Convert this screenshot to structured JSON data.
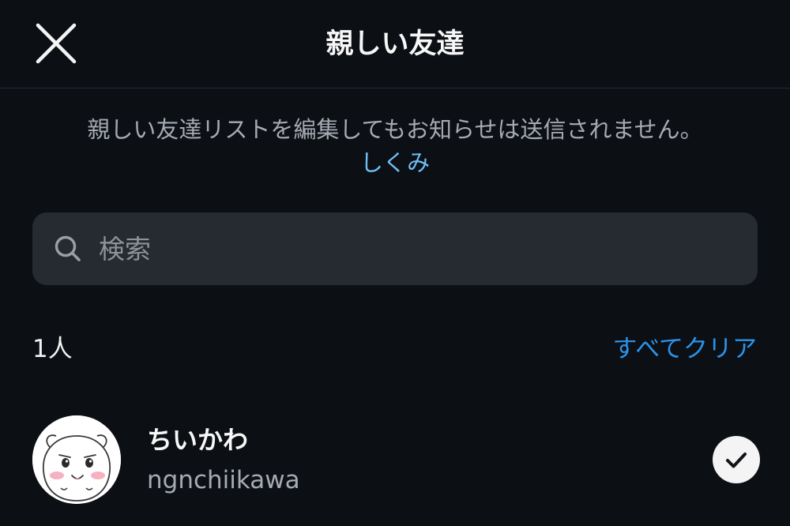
{
  "header": {
    "title": "親しい友達",
    "close_icon": "close-icon"
  },
  "notice": {
    "text": "親しい友達リストを編集してもお知らせは送信されません。",
    "link": "しくみ"
  },
  "search": {
    "placeholder": "検索",
    "value": "",
    "icon": "search-icon"
  },
  "list_header": {
    "count": "1人",
    "clear_all": "すべてクリア"
  },
  "users": [
    {
      "name": "ちいかわ",
      "handle": "ngnchiikawa",
      "selected": true,
      "avatar_icon": "chiikawa-avatar",
      "check_icon": "checkmark-icon"
    }
  ],
  "colors": {
    "background": "#0c0f14",
    "search_bg": "#262a31",
    "link": "#6fbef5",
    "accent": "#2b93ea",
    "secondary_text": "#a6aab3"
  }
}
